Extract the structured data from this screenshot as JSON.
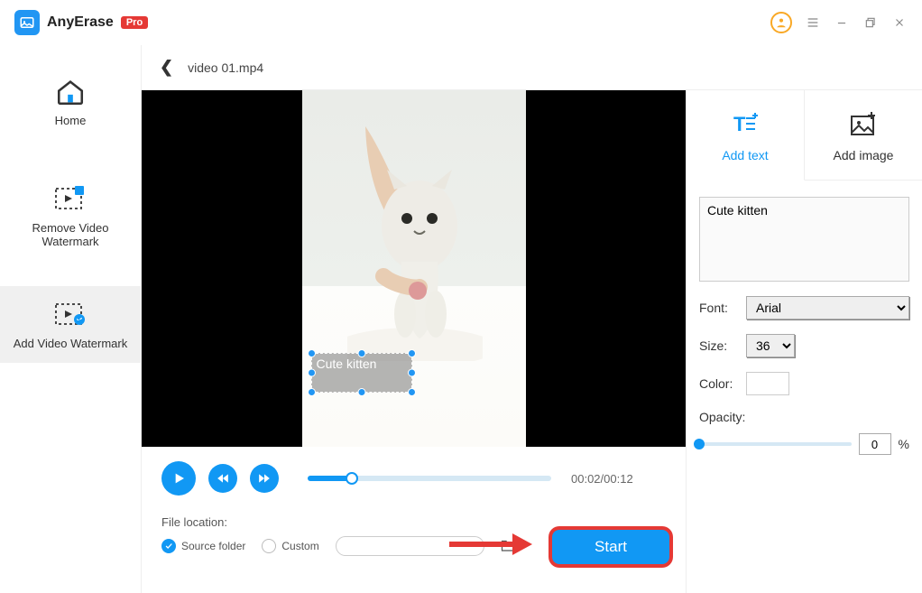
{
  "app": {
    "name": "AnyErase",
    "badge": "Pro"
  },
  "sidebar": {
    "items": [
      {
        "label": "Home"
      },
      {
        "label": "Remove Video Watermark"
      },
      {
        "label": "Add Video Watermark"
      }
    ]
  },
  "file": {
    "name": "video 01.mp4"
  },
  "overlay": {
    "text": "Cute kitten"
  },
  "playback": {
    "time_label": "00:02/00:12",
    "progress_pct": 18
  },
  "fileLocation": {
    "label": "File location:",
    "option_source": "Source folder",
    "option_custom": "Custom",
    "selected": "source",
    "custom_path": ""
  },
  "panel": {
    "tabs": [
      {
        "label": "Add text",
        "active": true
      },
      {
        "label": "Add image",
        "active": false
      }
    ],
    "text_value": "Cute kitten",
    "font_label": "Font:",
    "font_value": "Arial",
    "size_label": "Size:",
    "size_value": "36",
    "color_label": "Color:",
    "color_value": "#ffffff",
    "opacity_label": "Opacity:",
    "opacity_value": "0",
    "opacity_unit": "%"
  },
  "action": {
    "start_label": "Start"
  }
}
